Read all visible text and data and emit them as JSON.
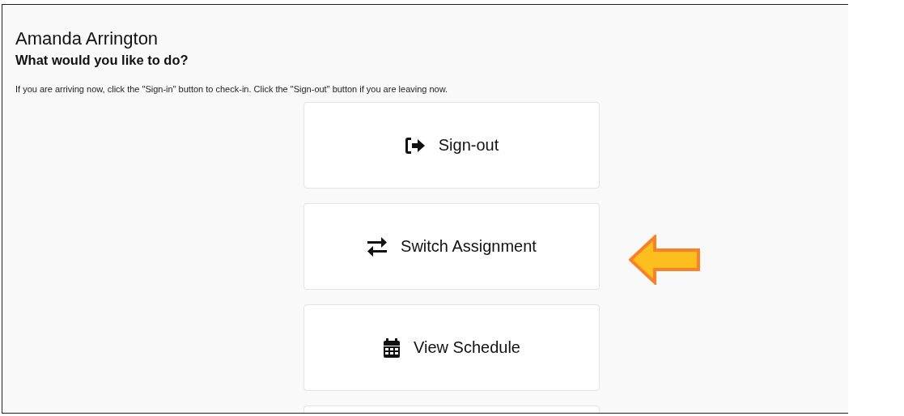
{
  "user": {
    "name": "Amanda Arrington"
  },
  "prompt": "What would you like to do?",
  "instructions": "If you are arriving now, click the \"Sign-in\" button to check-in. Click the \"Sign-out\" button if you are leaving now.",
  "actions": [
    {
      "kind": "sign-out",
      "label": "Sign-out"
    },
    {
      "kind": "switch",
      "label": "Switch Assignment"
    },
    {
      "kind": "schedule",
      "label": "View Schedule"
    }
  ]
}
